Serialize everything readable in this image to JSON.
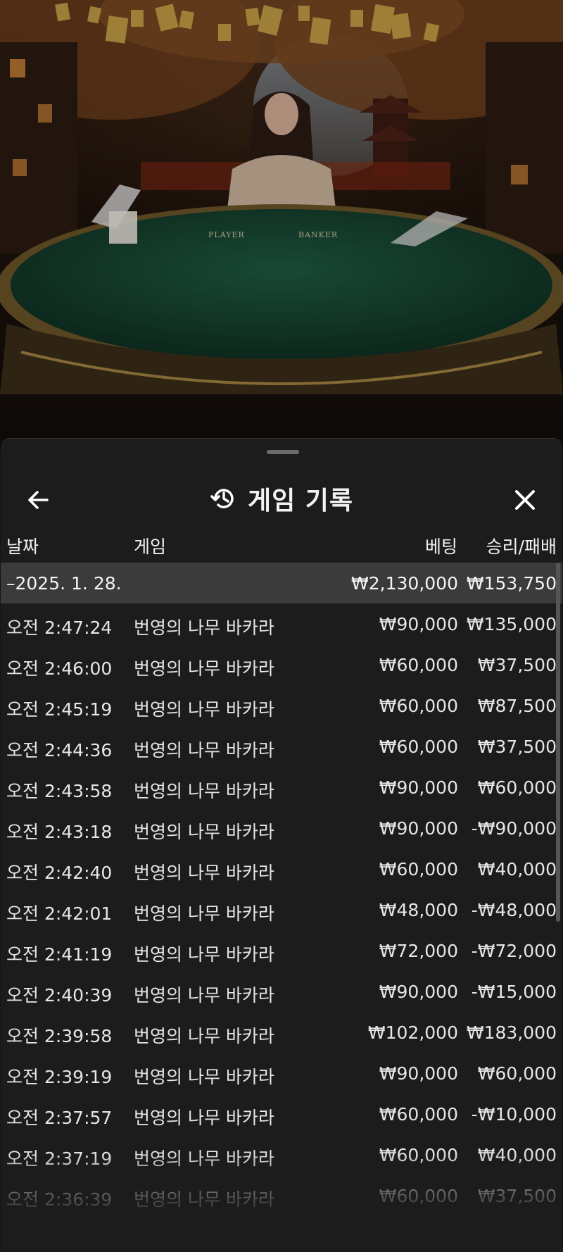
{
  "sheet": {
    "title": "게임 기록",
    "icons": {
      "back": "arrow-left-icon",
      "history": "history-icon",
      "close": "close-icon"
    }
  },
  "table": {
    "headers": {
      "date": "날짜",
      "game": "게임",
      "bet": "베팅",
      "result": "승리/패배"
    },
    "summary": {
      "date": "–2025. 1. 28.",
      "bet": "₩2,130,000",
      "result": "₩153,750"
    },
    "rows": [
      {
        "date": "오전 2:47:24",
        "game": "번영의 나무 바카라",
        "bet": "₩90,000",
        "result": "₩135,000"
      },
      {
        "date": "오전 2:46:00",
        "game": "번영의 나무 바카라",
        "bet": "₩60,000",
        "result": "₩37,500"
      },
      {
        "date": "오전 2:45:19",
        "game": "번영의 나무 바카라",
        "bet": "₩60,000",
        "result": "₩87,500"
      },
      {
        "date": "오전 2:44:36",
        "game": "번영의 나무 바카라",
        "bet": "₩60,000",
        "result": "₩37,500"
      },
      {
        "date": "오전 2:43:58",
        "game": "번영의 나무 바카라",
        "bet": "₩90,000",
        "result": "₩60,000"
      },
      {
        "date": "오전 2:43:18",
        "game": "번영의 나무 바카라",
        "bet": "₩90,000",
        "result": "-₩90,000"
      },
      {
        "date": "오전 2:42:40",
        "game": "번영의 나무 바카라",
        "bet": "₩60,000",
        "result": "₩40,000"
      },
      {
        "date": "오전 2:42:01",
        "game": "번영의 나무 바카라",
        "bet": "₩48,000",
        "result": "-₩48,000"
      },
      {
        "date": "오전 2:41:19",
        "game": "번영의 나무 바카라",
        "bet": "₩72,000",
        "result": "-₩72,000"
      },
      {
        "date": "오전 2:40:39",
        "game": "번영의 나무 바카라",
        "bet": "₩90,000",
        "result": "-₩15,000"
      },
      {
        "date": "오전 2:39:58",
        "game": "번영의 나무 바카라",
        "bet": "₩102,000",
        "result": "₩183,000"
      },
      {
        "date": "오전 2:39:19",
        "game": "번영의 나무 바카라",
        "bet": "₩90,000",
        "result": "₩60,000"
      },
      {
        "date": "오전 2:37:57",
        "game": "번영의 나무 바카라",
        "bet": "₩60,000",
        "result": "-₩10,000"
      },
      {
        "date": "오전 2:37:19",
        "game": "번영의 나무 바카라",
        "bet": "₩60,000",
        "result": "₩40,000"
      },
      {
        "date": "오전 2:36:39",
        "game": "번영의 나무 바카라",
        "bet": "₩60,000",
        "result": "₩37,500"
      }
    ]
  },
  "video": {
    "table_labels": {
      "player": "PLAYER",
      "banker": "BANKER"
    }
  },
  "colors": {
    "sheet_bg": "#1c1c1c",
    "summary_bg": "#3b3b3b",
    "text": "#e6e6e6",
    "felt": "#17402e"
  }
}
